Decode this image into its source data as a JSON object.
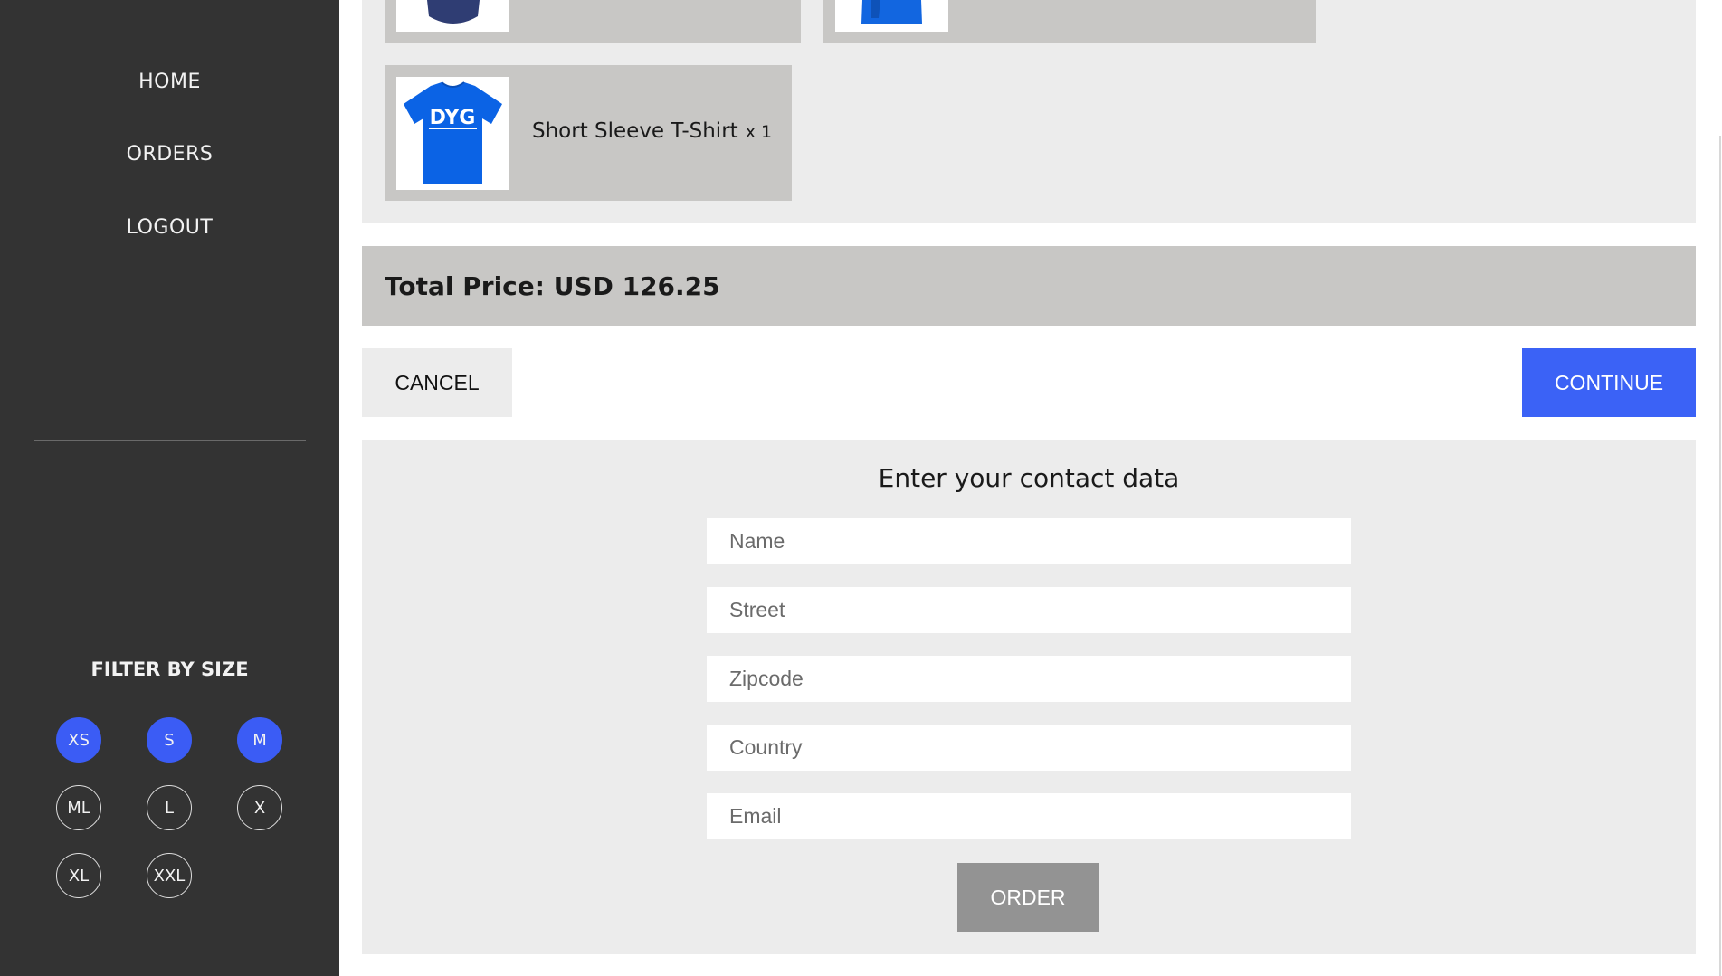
{
  "sidebar": {
    "nav": [
      {
        "label": "HOME"
      },
      {
        "label": "ORDERS"
      },
      {
        "label": "LOGOUT"
      }
    ],
    "filter_title": "FILTER BY SIZE",
    "sizes": [
      {
        "label": "XS",
        "active": true
      },
      {
        "label": "S",
        "active": true
      },
      {
        "label": "M",
        "active": true
      },
      {
        "label": "ML",
        "active": false
      },
      {
        "label": "L",
        "active": false
      },
      {
        "label": "X",
        "active": false
      },
      {
        "label": "XL",
        "active": false
      },
      {
        "label": "XXL",
        "active": false
      }
    ]
  },
  "cart": {
    "items": [
      {
        "name": "Short Sleeve T-Shirt",
        "qty": "x 1"
      }
    ],
    "total_label": "Total Price: USD 126.25"
  },
  "actions": {
    "cancel_label": "CANCEL",
    "continue_label": "CONTINUE"
  },
  "contact": {
    "title": "Enter your contact data",
    "fields": {
      "name_placeholder": "Name",
      "street_placeholder": "Street",
      "zipcode_placeholder": "Zipcode",
      "country_placeholder": "Country",
      "email_placeholder": "Email"
    },
    "order_label": "ORDER"
  },
  "colors": {
    "sidebar_bg": "#333333",
    "accent_blue": "#3b62f6",
    "panel_gray": "#ececec",
    "item_gray": "#c8c7c5",
    "order_gray": "#939393"
  }
}
